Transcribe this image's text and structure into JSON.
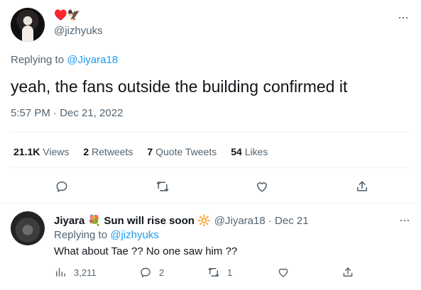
{
  "main_tweet": {
    "display_name_emojis": "♥️🦅",
    "handle": "@jizhyuks",
    "replying_prefix": "Replying to ",
    "replying_to": "@Jiyara18",
    "text": "yeah, the fans outside the building confirmed it",
    "timestamp": "5:57 PM · Dec 21, 2022",
    "stats": {
      "views_count": "21.1K",
      "views_label": "Views",
      "retweets_count": "2",
      "retweets_label": "Retweets",
      "quotes_count": "7",
      "quotes_label": "Quote Tweets",
      "likes_count": "54",
      "likes_label": "Likes"
    },
    "more_label": "···"
  },
  "reply": {
    "display_name": "Jiyara 💐 Sun will rise soon 🔆",
    "handle_date": "@Jiyara18 · Dec 21",
    "replying_prefix": "Replying to ",
    "replying_to": "@jizhyuks",
    "text": "What about Tae ?? No one saw him ??",
    "views": "3,211",
    "replies": "2",
    "retweets": "1",
    "more_label": "···"
  },
  "colors": {
    "accent": "#1d9bf0",
    "secondary_text": "#536471",
    "divider": "#eff3f4"
  },
  "icons": [
    "more-icon",
    "reply-icon",
    "retweet-icon",
    "like-icon",
    "share-icon",
    "views-icon"
  ]
}
